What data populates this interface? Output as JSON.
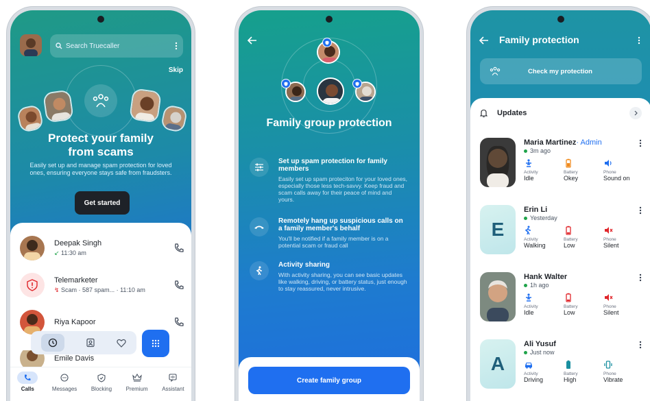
{
  "phone1": {
    "search_placeholder": "Search Truecaller",
    "skip_label": "Skip",
    "hero_title": "Protect your family from scams",
    "hero_subtitle": "Easily set up and manage spam protection for loved ones, ensuring everyone stays safe from fraudsters.",
    "get_started_label": "Get started",
    "calls": [
      {
        "name": "Deepak Singh",
        "meta": "11:30 am",
        "type": "incoming"
      },
      {
        "name": "Telemarketer",
        "meta": "Scam · 587 spam... · 11:10 am",
        "type": "scam"
      },
      {
        "name": "Riya Kapoor",
        "meta": "",
        "type": "missed"
      },
      {
        "name": "Emile Davis",
        "meta": "",
        "type": "incoming"
      }
    ],
    "nav": [
      {
        "label": "Calls",
        "icon": "phone-icon",
        "active": true
      },
      {
        "label": "Messages",
        "icon": "chat-icon",
        "active": false
      },
      {
        "label": "Blocking",
        "icon": "shield-icon",
        "active": false
      },
      {
        "label": "Premium",
        "icon": "crown-icon",
        "active": false
      },
      {
        "label": "Assistant",
        "icon": "assistant-icon",
        "active": false
      }
    ]
  },
  "phone2": {
    "title": "Family group protection",
    "features": [
      {
        "title": "Set up spam protection for family members",
        "desc": "Easily set up spam proteciton for your loved ones, especially those less tech-savvy. Keep fraud and scam calls away for their peace of mind and yours."
      },
      {
        "title": "Remotely hang up suspicious calls on a family member's behalf",
        "desc": "You'll be notified if a family member is on a potential scam or fraud call"
      },
      {
        "title": "Activity sharing",
        "desc": "With activity sharing, you can see basic updates like walking, driving, or battery status, just enough to stay reassured, never intrusive."
      }
    ],
    "create_label": "Create family group"
  },
  "phone3": {
    "title": "Family protection",
    "check_label": "Check my protection",
    "updates_label": "Updates",
    "members": [
      {
        "name": "Maria Martinez",
        "admin": "· Admin",
        "time": "3m ago",
        "activity": "Idle",
        "battery": "Okey",
        "phone": "Sound on",
        "battery_color": "#f08a1c"
      },
      {
        "name": "Erin Li",
        "admin": "",
        "time": "Yesterday",
        "activity": "Walking",
        "battery": "Low",
        "phone": "Silent",
        "letter": "E",
        "battery_color": "#e0262b"
      },
      {
        "name": "Hank Walter",
        "admin": "",
        "time": "1h ago",
        "activity": "Idle",
        "battery": "Low",
        "phone": "Silent",
        "battery_color": "#e0262b"
      },
      {
        "name": "Ali Yusuf",
        "admin": "",
        "time": "Just now",
        "activity": "Driving",
        "battery": "High",
        "phone": "Vibrate",
        "letter": "A",
        "battery_color": "#1a8fa0"
      }
    ],
    "stat_labels": {
      "activity": "Activity",
      "battery": "Battery",
      "phone": "Phone"
    }
  }
}
